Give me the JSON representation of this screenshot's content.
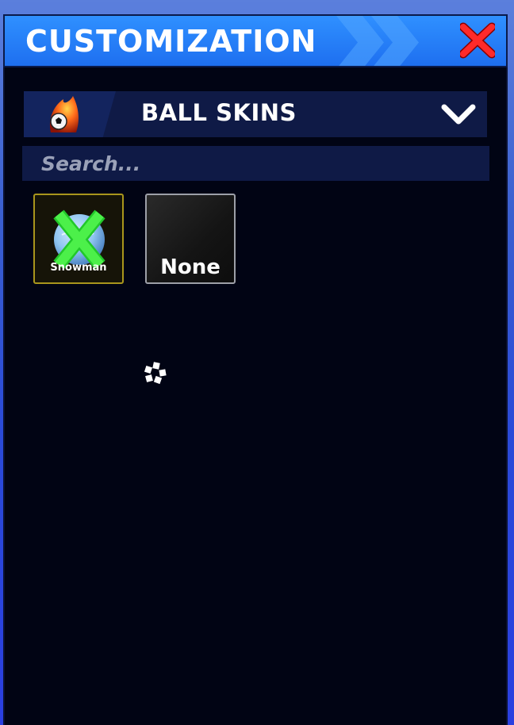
{
  "window": {
    "title": "CUSTOMIZATION",
    "close_icon": "close-x-icon",
    "colors": {
      "title_bar": "#2f90ff",
      "close": "#ff2a2a",
      "panel": "#010414"
    }
  },
  "category_selector": {
    "label": "BALL SKINS",
    "icon": "flaming-ball-icon",
    "chevron": "chevron-down-icon"
  },
  "search": {
    "placeholder": "Search...",
    "value": ""
  },
  "items": [
    {
      "name": "Snowman",
      "icon": "snowman-ball-icon",
      "equipped_mark": "green-x-icon",
      "border": "#a9961c"
    },
    {
      "name": "None",
      "border": "#9da0a8"
    }
  ],
  "loading_icon": "loading-spinner-icon"
}
